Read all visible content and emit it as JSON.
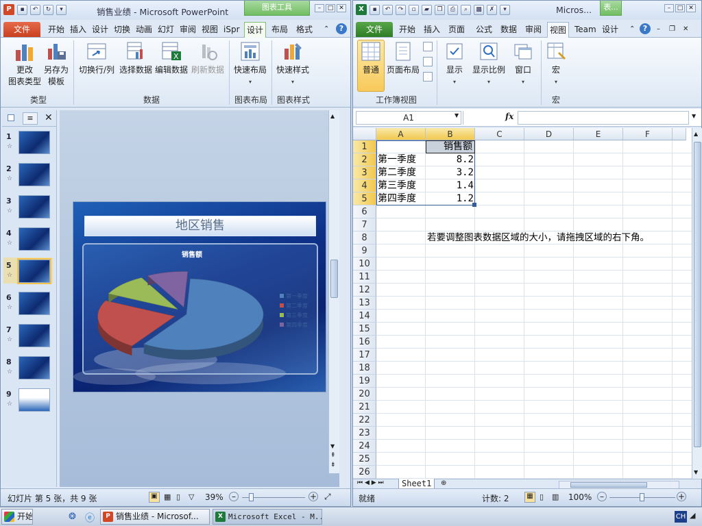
{
  "ppt": {
    "title": "销售业绩 - Microsoft PowerPoint",
    "context_tool": "图表工具",
    "tabs": [
      "文件",
      "开始",
      "插入",
      "设计",
      "切换",
      "动画",
      "幻灯",
      "审阅",
      "视图",
      "iSpr",
      "设计",
      "布局",
      "格式"
    ],
    "ribbon": {
      "change_type": "更改\n图表类型",
      "save_template": "另存为\n模板",
      "switch_rowcol": "切换行/列",
      "select_data": "选择数据",
      "edit_data": "编辑数据",
      "refresh_data": "刷新数据",
      "quick_layout": "快速布局",
      "quick_style": "快速样式",
      "group_type": "类型",
      "group_data": "数据",
      "group_layout": "图表布局",
      "group_style": "图表样式"
    },
    "thumbs": [
      "1",
      "2",
      "3",
      "4",
      "5",
      "6",
      "7",
      "8",
      "9"
    ],
    "star": "☆",
    "slide_title": "地区销售",
    "chart_title": "销售额",
    "status_left": "幻灯片 第 5 张，共 9 张",
    "zoom": "39%"
  },
  "chart_data": {
    "type": "pie",
    "title": "销售额",
    "categories": [
      "第一季度",
      "第二季度",
      "第三季度",
      "第四季度"
    ],
    "values": [
      8.2,
      3.2,
      1.4,
      1.2
    ],
    "colors": [
      "#4f81bd",
      "#c0504d",
      "#9bbb59",
      "#8064a2"
    ],
    "legend_position": "right"
  },
  "excel": {
    "title": "Micros...",
    "context_tool": "表...",
    "tabs": [
      "文件",
      "开始",
      "插入",
      "页面",
      "公式",
      "数据",
      "审阅",
      "视图",
      "Team",
      "设计"
    ],
    "ribbon": {
      "normal": "普通",
      "page_layout": "页面布局",
      "show": "显示",
      "zoom": "显示比例",
      "window": "窗口",
      "macro": "宏",
      "group_views": "工作簿视图",
      "group_macro": "宏"
    },
    "name_box": "A1",
    "fx": "fx",
    "columns": [
      "A",
      "B",
      "C",
      "D",
      "E",
      "F"
    ],
    "rows": [
      "1",
      "2",
      "3",
      "4",
      "5",
      "6",
      "7",
      "8",
      "9",
      "10",
      "11",
      "12",
      "13",
      "14",
      "15",
      "16",
      "17",
      "18",
      "19",
      "20",
      "21",
      "22",
      "23",
      "24",
      "25",
      "26"
    ],
    "header_b1": "销售额",
    "data_rows": [
      {
        "a": "第一季度",
        "b": "8.2"
      },
      {
        "a": "第二季度",
        "b": "3.2"
      },
      {
        "a": "第三季度",
        "b": "1.4"
      },
      {
        "a": "第四季度",
        "b": "1.2"
      }
    ],
    "note": "若要调整图表数据区域的大小，请拖拽区域的右下角。",
    "sheet_tab": "Sheet1",
    "status_ready": "就绪",
    "status_count": "计数: 2",
    "zoom": "100%"
  },
  "taskbar": {
    "start": "开始",
    "ppt_btn": "销售业绩 - Microsof...",
    "xl_btn": "Microsoft Excel - M...",
    "lang": "CH"
  }
}
